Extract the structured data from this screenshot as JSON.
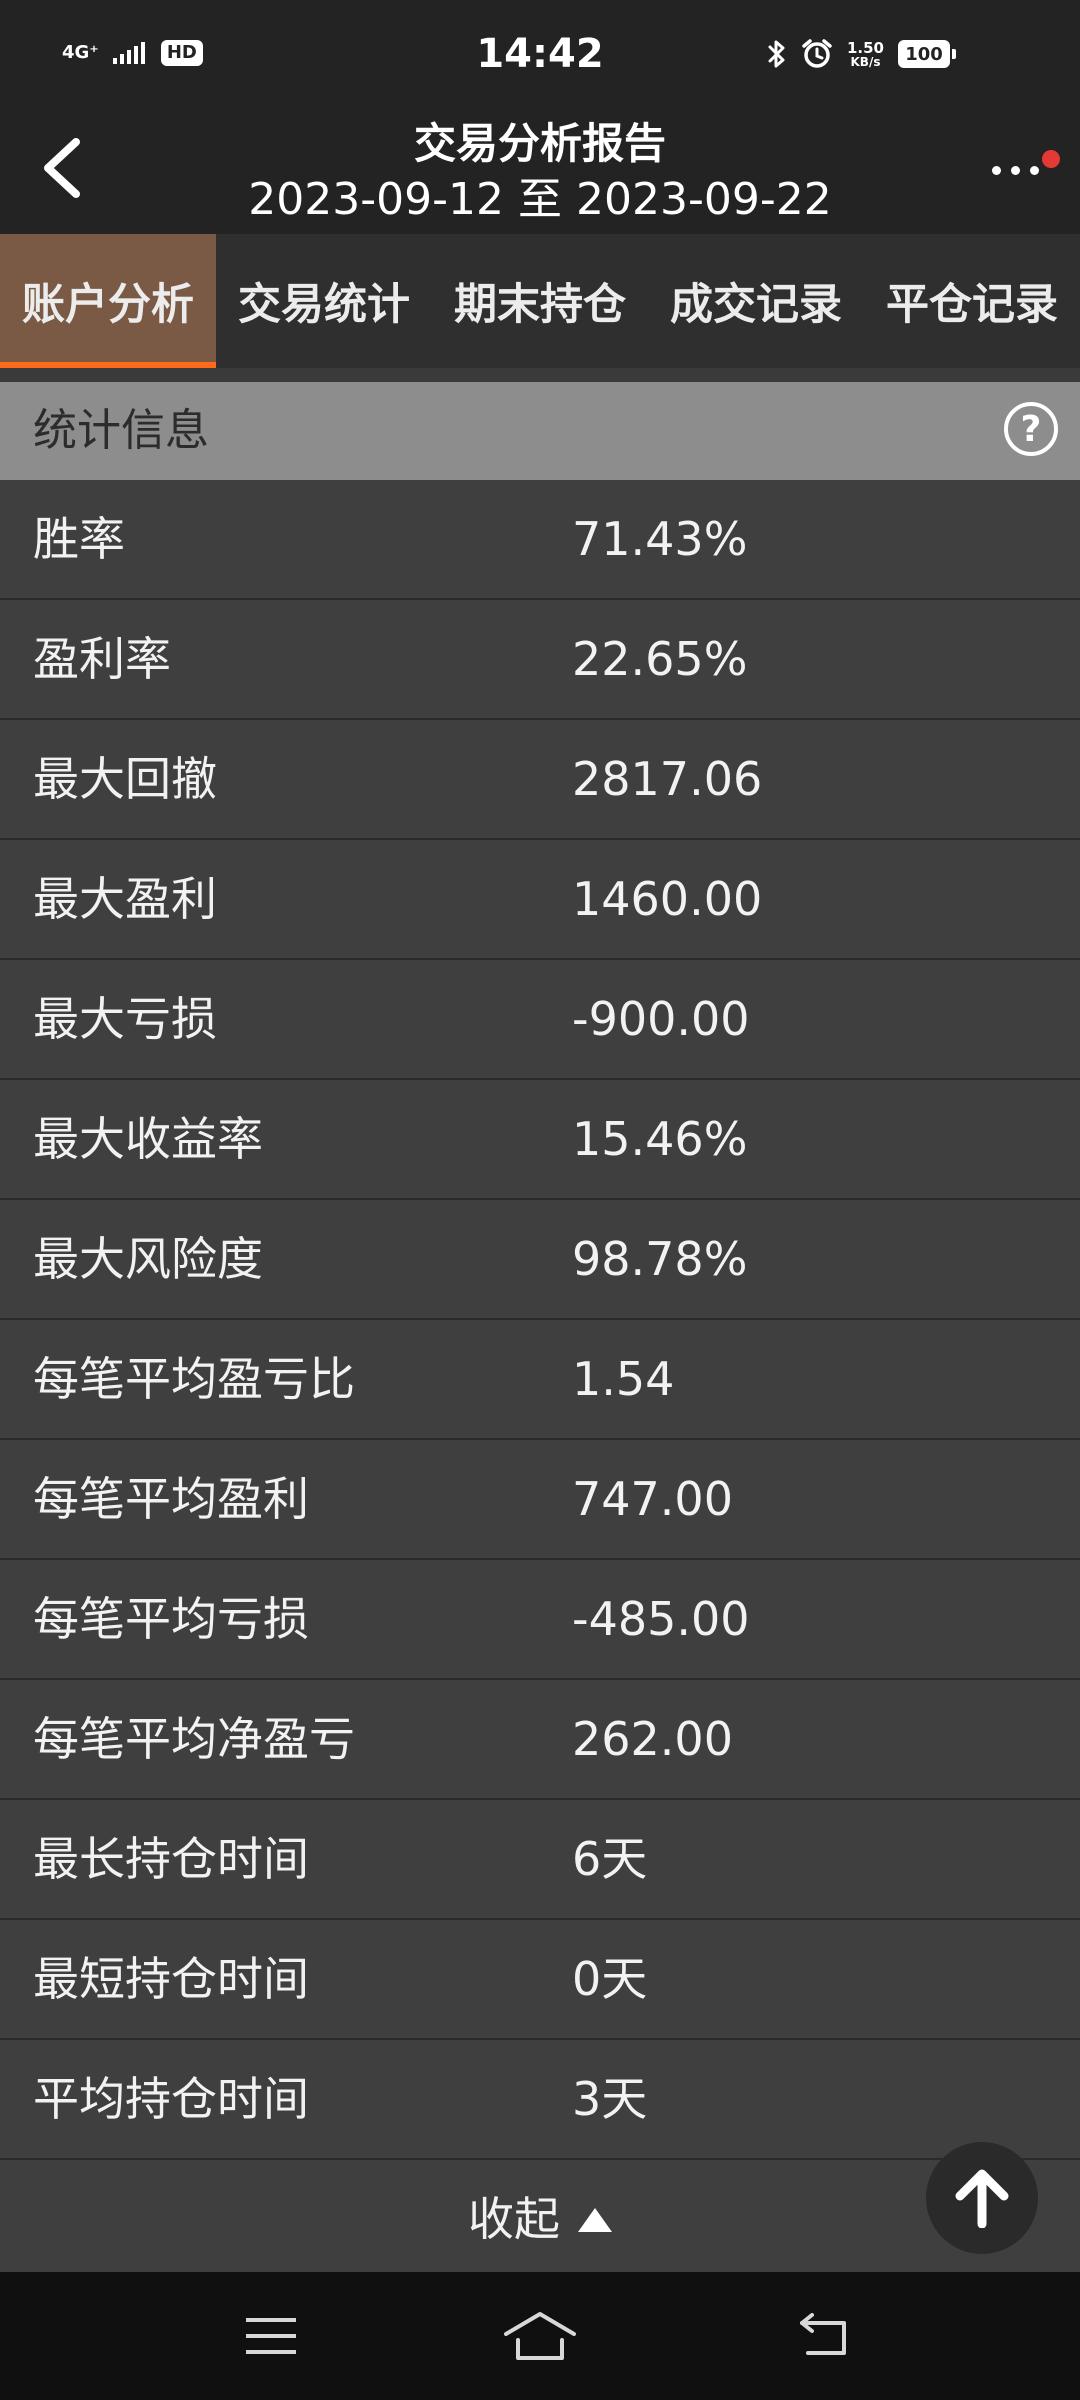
{
  "status_bar": {
    "signal": "4G⁺",
    "hd": "HD",
    "time": "14:42",
    "net_speed_value": "1.50",
    "net_speed_unit": "KB/s",
    "battery": "100"
  },
  "header": {
    "title": "交易分析报告",
    "date_range": "2023-09-12 至 2023-09-22"
  },
  "tabs": [
    {
      "label": "账户分析",
      "active": true
    },
    {
      "label": "交易统计",
      "active": false
    },
    {
      "label": "期末持仓",
      "active": false
    },
    {
      "label": "成交记录",
      "active": false
    },
    {
      "label": "平仓记录",
      "active": false
    }
  ],
  "section": {
    "title": "统计信息",
    "help": "?"
  },
  "stats": [
    {
      "label": "胜率",
      "value": "71.43%"
    },
    {
      "label": "盈利率",
      "value": "22.65%"
    },
    {
      "label": "最大回撤",
      "value": "2817.06"
    },
    {
      "label": "最大盈利",
      "value": "1460.00"
    },
    {
      "label": "最大亏损",
      "value": "-900.00"
    },
    {
      "label": "最大收益率",
      "value": "15.46%"
    },
    {
      "label": "最大风险度",
      "value": "98.78%"
    },
    {
      "label": "每笔平均盈亏比",
      "value": "1.54"
    },
    {
      "label": "每笔平均盈利",
      "value": "747.00"
    },
    {
      "label": "每笔平均亏损",
      "value": "-485.00"
    },
    {
      "label": "每笔平均净盈亏",
      "value": "262.00"
    },
    {
      "label": "最长持仓时间",
      "value": "6天"
    },
    {
      "label": "最短持仓时间",
      "value": "0天"
    },
    {
      "label": "平均持仓时间",
      "value": "3天"
    }
  ],
  "collapse": {
    "label": "收起"
  },
  "colors": {
    "background": "#3f3f3f",
    "header": "#232323",
    "active_tab": "#7a5a45",
    "tab_indicator": "#ff6a1a",
    "section_header": "#8d8d8d",
    "notification_dot": "#e53935"
  },
  "icons": {
    "back": "chevron-left-icon",
    "more": "more-dots-icon",
    "help": "question-circle-icon",
    "collapse": "triangle-up-icon",
    "scroll_top": "arrow-up-icon",
    "nav_menu": "menu-icon",
    "nav_home": "home-icon",
    "nav_back": "back-arrow-icon"
  }
}
